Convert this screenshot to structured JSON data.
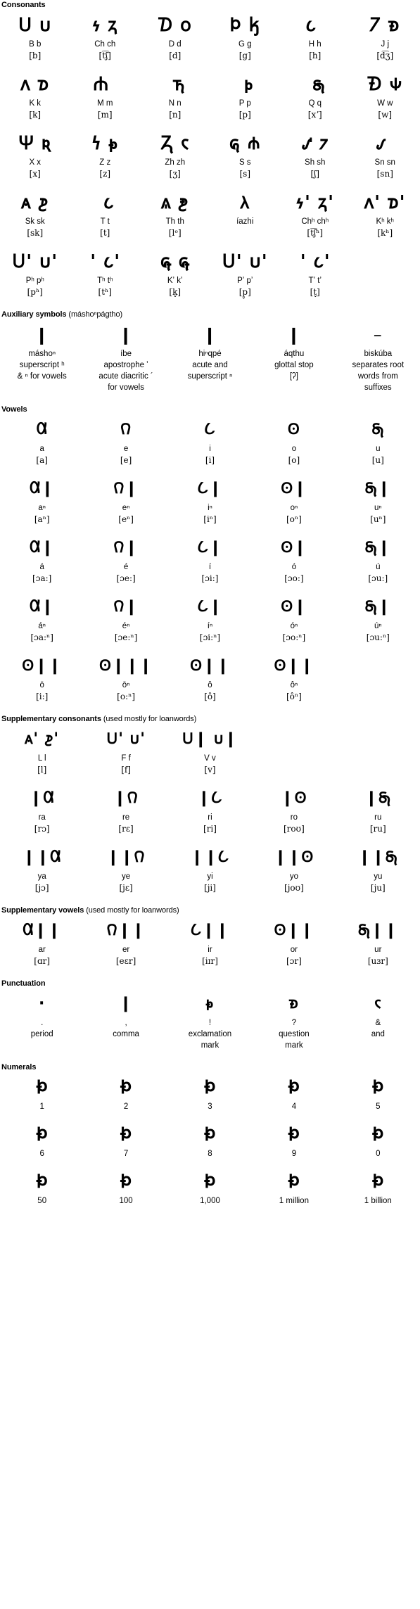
{
  "sections": {
    "consonants": {
      "heading": "Consonants",
      "rows": [
        [
          {
            "glyph": "𐓎 𐓶",
            "name": "B b",
            "ipa": "[b]"
          },
          {
            "glyph": "𐓷 𐓻",
            "name": "Ch ch",
            "ipa": "[t͡ʃ]"
          },
          {
            "glyph": "𐓈 𐓪",
            "name": "D d",
            "ipa": "[d]"
          },
          {
            "glyph": "𐓄 𐓤",
            "name": "G g",
            "ipa": "[g]"
          },
          {
            "glyph": "𐓧 𐓽",
            "name": "H h",
            "ipa": "[h]"
          },
          {
            "glyph": "𐓒 𐓱",
            "name": "J j",
            "ipa": "[d͡ʒ]"
          }
        ],
        [
          {
            "glyph": "𐓘 𐓰",
            "name": "K k",
            "ipa": "[k]"
          },
          {
            "glyph": "𐓐 𐓿",
            "name": "M m",
            "ipa": "[m]"
          },
          {
            "glyph": "𐓕 𐓵",
            "name": "N n",
            "ipa": "[n]"
          },
          {
            "glyph": "𐓔 𐓬",
            "name": "P p",
            "ipa": "[p]"
          },
          {
            "glyph": "𐓖 𐓯",
            "name": "Q q",
            "ipa": "[xʼ]"
          },
          {
            "glyph": "𐓉 𐓹",
            "name": "W w",
            "ipa": "[w]"
          }
        ],
        [
          {
            "glyph": "𐓑 𐓜",
            "name": "X x",
            "ipa": "[x]"
          },
          {
            "glyph": "𐓏 𐓭",
            "name": "Z z",
            "ipa": "[z]"
          },
          {
            "glyph": "𐓓 𐓮",
            "name": "Zh zh",
            "ipa": "[ʒ]"
          },
          {
            "glyph": "𐓝 𐓸",
            "name": "S s",
            "ipa": "[s]"
          },
          {
            "glyph": "𐓢 𐓺",
            "name": "Sh sh",
            "ipa": "[ʃ]"
          },
          {
            "glyph": "𐓡 𐓼",
            "name": "Sn sn",
            "ipa": "[sn]"
          }
        ],
        [
          {
            "glyph": "𐓚 𐓲",
            "name": "Sk sk",
            "ipa": "[sk]"
          },
          {
            "glyph": "𐓗 𐓧",
            "name": "T t",
            "ipa": "[t]"
          },
          {
            "glyph": "𐓙 𐓳",
            "name": "Th th",
            "ipa": "[lᵒ]"
          },
          {
            "glyph": "𐓛",
            "name": "íazhi",
            "ipa": ""
          },
          {
            "glyph": "𐓷ꞌ 𐓻ꞌ",
            "name": "Chʰ chʰ",
            "ipa": "[t͡ʃʰ]"
          },
          {
            "glyph": "𐓘ꞌ 𐓰ꞌ",
            "name": "Kʰ kʰ",
            "ipa": "[kʰ]"
          }
        ],
        [
          {
            "glyph": "𐓎ꞌ 𐓶ꞌ",
            "name": "Pʰ pʰ",
            "ipa": "[pʰ]"
          },
          {
            "glyph": "𐓗ꞌ 𐓧ꞌ",
            "name": "Tʰ tʰ",
            "ipa": "[tʰ]"
          },
          {
            "glyph": "𐓞 𐓞",
            "name": "Kʼ kʼ",
            "ipa": "[k̬]"
          },
          {
            "glyph": "𐓎ꞌ 𐓶ꞌ",
            "name": "Pʼ pʼ",
            "ipa": "[p̬]"
          },
          {
            "glyph": "𐓗ꞌ 𐓧ꞌ",
            "name": "Tʼ tʼ",
            "ipa": "[t̬]"
          },
          {
            "glyph": "",
            "name": "",
            "ipa": ""
          }
        ]
      ]
    },
    "auxiliary": {
      "heading_bold": "Auxiliary symbols",
      "heading_paren": "(máshoⁿpágtho)",
      "items": [
        {
          "glyph": "❙",
          "name": "máshoⁿ",
          "lines": [
            "superscript ʰ",
            "& ⁿ for vowels"
          ]
        },
        {
          "glyph": "❙",
          "name": "íbe",
          "lines": [
            "apostrophe ʼ",
            "acute diacritic ´",
            "for vowels"
          ]
        },
        {
          "glyph": "❙",
          "name": "hiⁿqpé",
          "lines": [
            "acute and",
            "superscript ⁿ"
          ]
        },
        {
          "glyph": "❙",
          "name": "áqthu",
          "lines": [
            "glottal stop",
            "[ʔ]"
          ]
        },
        {
          "glyph": "–",
          "name": "biskúba",
          "lines": [
            "separates root",
            "words from",
            "suffixes"
          ]
        }
      ]
    },
    "vowels": {
      "heading": "Vowels",
      "rows": [
        [
          {
            "glyph": "𐒷",
            "name": "a",
            "ipa": "[a]"
          },
          {
            "glyph": "𐒻",
            "name": "e",
            "ipa": "[e]"
          },
          {
            "glyph": "𐒿",
            "name": "i",
            "ipa": "[i]"
          },
          {
            "glyph": "𐓃",
            "name": "o",
            "ipa": "[o]"
          },
          {
            "glyph": "𐓇",
            "name": "u",
            "ipa": "[u]"
          }
        ],
        [
          {
            "glyph": "𐒷❙",
            "name": "aⁿ",
            "ipa": "[aⁿ]"
          },
          {
            "glyph": "𐒻❙",
            "name": "eⁿ",
            "ipa": "[eⁿ]"
          },
          {
            "glyph": "𐒿❙",
            "name": "iⁿ",
            "ipa": "[iⁿ]"
          },
          {
            "glyph": "𐓃❙",
            "name": "oⁿ",
            "ipa": "[oⁿ]"
          },
          {
            "glyph": "𐓇❙",
            "name": "uⁿ",
            "ipa": "[uⁿ]"
          }
        ],
        [
          {
            "glyph": "𐒷❙",
            "name": "á",
            "ipa": "[ɔa:]"
          },
          {
            "glyph": "𐒻❙",
            "name": "é",
            "ipa": "[ɔe:]"
          },
          {
            "glyph": "𐒿❙",
            "name": "í",
            "ipa": "[ɔi:]"
          },
          {
            "glyph": "𐓃❙",
            "name": "ó",
            "ipa": "[ɔo:]"
          },
          {
            "glyph": "𐓇❙",
            "name": "ú",
            "ipa": "[ɔu:]"
          }
        ],
        [
          {
            "glyph": "𐒷❙",
            "name": "áⁿ",
            "ipa": "[ɔa:ⁿ]"
          },
          {
            "glyph": "𐒻❙",
            "name": "éⁿ",
            "ipa": "[ɔe:ⁿ]"
          },
          {
            "glyph": "𐒿❙",
            "name": "íⁿ",
            "ipa": "[ɔi:ⁿ]"
          },
          {
            "glyph": "𐓃❙",
            "name": "óⁿ",
            "ipa": "[ɔo:ⁿ]"
          },
          {
            "glyph": "𐓇❙",
            "name": "úⁿ",
            "ipa": "[ɔu:ⁿ]"
          }
        ],
        [
          {
            "glyph": "𐓃❙❙",
            "name": "ō",
            "ipa": "[i:]"
          },
          {
            "glyph": "𐓃❙❙❙",
            "name": "ōⁿ",
            "ipa": "[o:ⁿ]"
          },
          {
            "glyph": "𐓃❙❙",
            "name": "ô",
            "ipa": "[ô]"
          },
          {
            "glyph": "𐓃❙❙",
            "name": "ôⁿ",
            "ipa": "[ôⁿ]"
          },
          {
            "glyph": "",
            "name": "",
            "ipa": ""
          }
        ]
      ]
    },
    "supp_consonants": {
      "heading_bold": "Supplementary consonants",
      "heading_normal": "(used mostly for loanwords)",
      "rows": [
        [
          {
            "glyph": "𐓚ꞌ 𐓲ꞌ",
            "name": "L l",
            "ipa": "[l]"
          },
          {
            "glyph": "𐓎ꞌ 𐓶ꞌ",
            "name": "F f",
            "ipa": "[f]"
          },
          {
            "glyph": "𐓎❙ 𐓶❙",
            "name": "V v",
            "ipa": "[v]"
          },
          {
            "glyph": "",
            "name": "",
            "ipa": ""
          },
          {
            "glyph": "",
            "name": "",
            "ipa": ""
          }
        ],
        [
          {
            "glyph": "❙𐒷",
            "name": "ra",
            "ipa": "[rɔ]"
          },
          {
            "glyph": "❙𐒻",
            "name": "re",
            "ipa": "[rɛ]"
          },
          {
            "glyph": "❙𐒿",
            "name": "ri",
            "ipa": "[ri]"
          },
          {
            "glyph": "❙𐓃",
            "name": "ro",
            "ipa": "[roʊ]"
          },
          {
            "glyph": "❙𐓇",
            "name": "ru",
            "ipa": "[ru]"
          }
        ],
        [
          {
            "glyph": "❙❙𐒷",
            "name": "ya",
            "ipa": "[jɔ]"
          },
          {
            "glyph": "❙❙𐒻",
            "name": "ye",
            "ipa": "[jɛ]"
          },
          {
            "glyph": "❙❙𐒿",
            "name": "yi",
            "ipa": "[ji]"
          },
          {
            "glyph": "❙❙𐓃",
            "name": "yo",
            "ipa": "[joʊ]"
          },
          {
            "glyph": "❙❙𐓇",
            "name": "yu",
            "ipa": "[ju]"
          }
        ]
      ]
    },
    "supp_vowels": {
      "heading_bold": "Supplementary vowels",
      "heading_normal": "(used mostly for loanwords)",
      "rows": [
        [
          {
            "glyph": "𐒷❙❙",
            "name": "ar",
            "ipa": "[ɑr]"
          },
          {
            "glyph": "𐒻❙❙",
            "name": "er",
            "ipa": "[eɛr]"
          },
          {
            "glyph": "𐒿❙❙",
            "name": "ir",
            "ipa": "[iɪr]"
          },
          {
            "glyph": "𐓃❙❙",
            "name": "or",
            "ipa": "[ɔr]"
          },
          {
            "glyph": "𐓇❙❙",
            "name": "ur",
            "ipa": "[uɜr]"
          }
        ]
      ]
    },
    "punctuation": {
      "heading": "Punctuation",
      "items": [
        {
          "glyph": "·",
          "symbol": ".",
          "lines": [
            "period"
          ]
        },
        {
          "glyph": "❙",
          "symbol": ",",
          "lines": [
            "comma"
          ]
        },
        {
          "glyph": "𐓭",
          "symbol": "!",
          "lines": [
            "exclamation",
            "mark"
          ]
        },
        {
          "glyph": "𐓱",
          "symbol": "?",
          "lines": [
            "question",
            "mark"
          ]
        },
        {
          "glyph": "𐓮",
          "symbol": "&",
          "lines": [
            "and"
          ]
        }
      ]
    },
    "numerals": {
      "heading": "Numerals",
      "rows": [
        [
          {
            "glyph": "𐓅",
            "value": "1"
          },
          {
            "glyph": "𐓅",
            "value": "2"
          },
          {
            "glyph": "𐓅",
            "value": "3"
          },
          {
            "glyph": "𐓅",
            "value": "4"
          },
          {
            "glyph": "𐓅",
            "value": "5"
          }
        ],
        [
          {
            "glyph": "𐓅",
            "value": "6"
          },
          {
            "glyph": "𐓅",
            "value": "7"
          },
          {
            "glyph": "𐓅",
            "value": "8"
          },
          {
            "glyph": "𐓅",
            "value": "9"
          },
          {
            "glyph": "𐓅",
            "value": "0"
          }
        ],
        [
          {
            "glyph": "𐓅",
            "value": "50"
          },
          {
            "glyph": "𐓅",
            "value": "100"
          },
          {
            "glyph": "𐓅",
            "value": "1,000"
          },
          {
            "glyph": "𐓅",
            "value": "1 million"
          },
          {
            "glyph": "𐓅",
            "value": "1 billion"
          }
        ]
      ]
    }
  }
}
